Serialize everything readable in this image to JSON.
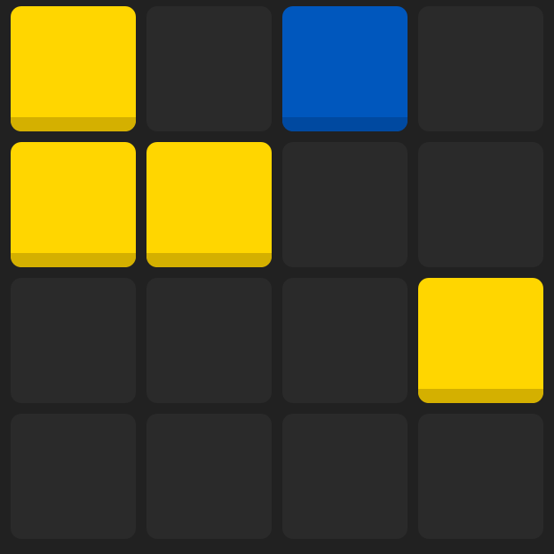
{
  "board": {
    "rows": 4,
    "cols": 4,
    "colors": {
      "background": "#212121",
      "empty": "#2a2a2a",
      "yellow": "#ffd600",
      "yellow_shade": "#d4b000",
      "blue": "#0057bd",
      "blue_shade": "#0049a0"
    },
    "cells": [
      [
        "yellow",
        "empty",
        "blue",
        "empty"
      ],
      [
        "yellow",
        "yellow",
        "empty",
        "empty"
      ],
      [
        "empty",
        "empty",
        "empty",
        "yellow"
      ],
      [
        "empty",
        "empty",
        "empty",
        "empty"
      ]
    ]
  }
}
